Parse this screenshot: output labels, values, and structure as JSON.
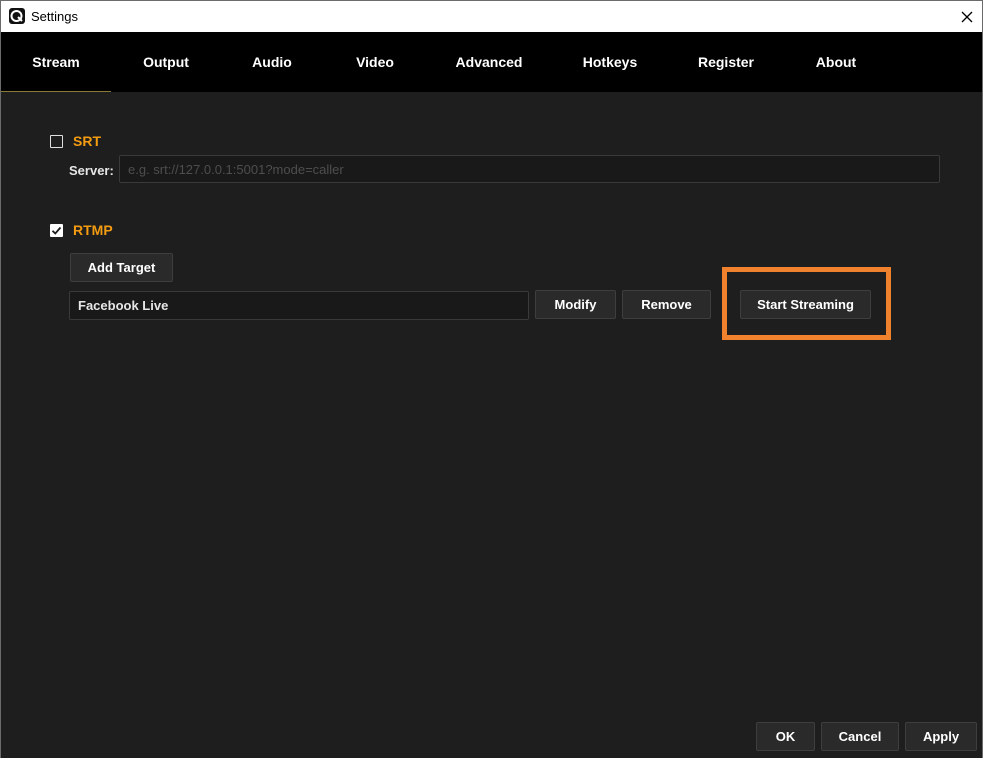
{
  "window": {
    "title": "Settings",
    "close_glyph": "✕"
  },
  "tabs": [
    {
      "label": "Stream",
      "active": true
    },
    {
      "label": "Output"
    },
    {
      "label": "Audio"
    },
    {
      "label": "Video"
    },
    {
      "label": "Advanced"
    },
    {
      "label": "Hotkeys"
    },
    {
      "label": "Register"
    },
    {
      "label": "About"
    }
  ],
  "srt": {
    "label": "SRT",
    "checked": false,
    "server_label": "Server:",
    "server_value": "",
    "server_placeholder": "e.g. srt://127.0.0.1:5001?mode=caller"
  },
  "rtmp": {
    "label": "RTMP",
    "checked": true,
    "add_target_label": "Add Target",
    "target_value": "Facebook Live",
    "modify_label": "Modify",
    "remove_label": "Remove",
    "start_streaming_label": "Start Streaming"
  },
  "footer": {
    "ok_label": "OK",
    "cancel_label": "Cancel",
    "apply_label": "Apply"
  },
  "colors": {
    "accent": "#f39c12",
    "highlight": "#f0822e",
    "background": "#1e1e1e",
    "tabbar": "#000000"
  }
}
